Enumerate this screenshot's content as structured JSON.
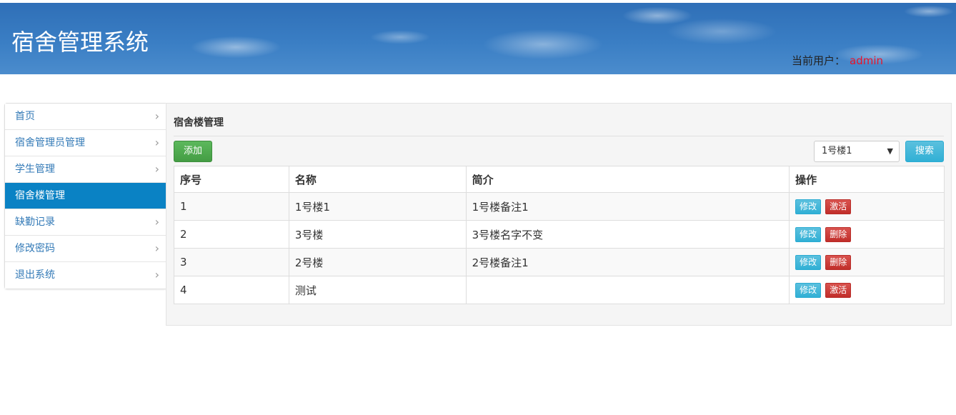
{
  "header": {
    "title": "宿舍管理系统",
    "user_label": "当前用户：",
    "user_name": "admin"
  },
  "sidebar": {
    "items": [
      {
        "label": "首页",
        "active": false
      },
      {
        "label": "宿舍管理员管理",
        "active": false
      },
      {
        "label": "学生管理",
        "active": false
      },
      {
        "label": "宿舍楼管理",
        "active": true
      },
      {
        "label": "缺勤记录",
        "active": false
      },
      {
        "label": "修改密码",
        "active": false
      },
      {
        "label": "退出系统",
        "active": false
      }
    ],
    "chevron_icon": "chevron-right-icon"
  },
  "main": {
    "title": "宿舍楼管理",
    "add_button": "添加",
    "building_select": {
      "selected": "1号楼1"
    },
    "search_button": "搜索",
    "table": {
      "headers": [
        "序号",
        "名称",
        "简介",
        "操作"
      ],
      "rows": [
        {
          "id": "1",
          "name": "1号楼1",
          "desc": "1号楼备注1",
          "edit": "修改",
          "action": "激活"
        },
        {
          "id": "2",
          "name": "3号楼",
          "desc": "3号楼名字不变",
          "edit": "修改",
          "action": "删除"
        },
        {
          "id": "3",
          "name": "2号楼",
          "desc": "2号楼备注1",
          "edit": "修改",
          "action": "删除"
        },
        {
          "id": "4",
          "name": "测试",
          "desc": "",
          "edit": "修改",
          "action": "激活"
        }
      ]
    }
  },
  "colors": {
    "header_blue": "#3a7ec4",
    "active_nav": "#0a82c4",
    "user_name": "#e8142a",
    "add_green": "#5cb85c",
    "info_blue": "#5bc0de",
    "danger_red": "#d9534f"
  }
}
